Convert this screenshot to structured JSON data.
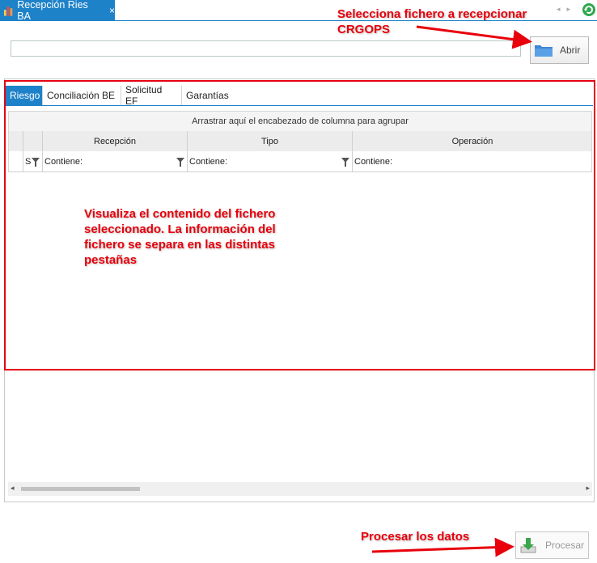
{
  "window": {
    "tab_title": "Recepción Ries BA",
    "tab_close": "×",
    "nav_prev": "◂",
    "nav_next": "▸"
  },
  "file_select": {
    "value": "",
    "open_button_label": "Abrir"
  },
  "tabs": [
    {
      "label": "Riesgo",
      "active": true
    },
    {
      "label": "Conciliación BE",
      "active": false
    },
    {
      "label": "Solicitud EF",
      "active": false
    },
    {
      "label": "Garantías",
      "active": false
    }
  ],
  "grid": {
    "group_panel_text": "Arrastrar aquí el encabezado de columna para agrupar",
    "selector_column_label": "S",
    "columns": [
      {
        "header": "Recepción",
        "filter": "Contiene:"
      },
      {
        "header": "Tipo",
        "filter": "Contiene:"
      },
      {
        "header": "Operación",
        "filter": "Contiene:"
      }
    ],
    "rows": []
  },
  "scrollbar": {
    "left_arrow": "◂",
    "right_arrow": "▸"
  },
  "process": {
    "button_label": "Procesar"
  },
  "annotations": {
    "select_file": "Selecciona fichero a recepcionar CRGOPS",
    "view_content": "Visualiza el contenido del fichero seleccionado. La información del fichero se separa en las distintas pestañas",
    "process_data": "Procesar los datos"
  },
  "colors": {
    "accent": "#1e82c9",
    "annotation_red": "#e8000b"
  }
}
